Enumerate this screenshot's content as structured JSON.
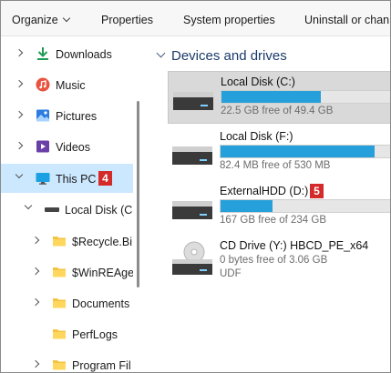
{
  "toolbar": {
    "organize": "Organize",
    "properties": "Properties",
    "system_properties": "System properties",
    "uninstall": "Uninstall or chan"
  },
  "nav": {
    "items": [
      {
        "label": "Downloads",
        "icon": "download-icon"
      },
      {
        "label": "Music",
        "icon": "music-icon"
      },
      {
        "label": "Pictures",
        "icon": "pictures-icon"
      },
      {
        "label": "Videos",
        "icon": "videos-icon"
      },
      {
        "label": "This PC",
        "icon": "computer-icon",
        "badge": "4",
        "selected": true
      },
      {
        "label": "Local Disk (C",
        "icon": "drive-icon"
      },
      {
        "label": "$Recycle.Bi",
        "icon": "folder-icon"
      },
      {
        "label": "$WinREAge",
        "icon": "folder-icon"
      },
      {
        "label": "Documents",
        "icon": "folder-icon"
      },
      {
        "label": "PerfLogs",
        "icon": "folder-icon"
      },
      {
        "label": "Program Fil",
        "icon": "folder-icon"
      }
    ]
  },
  "content": {
    "section_title": "Devices and drives",
    "drives": [
      {
        "name": "Local Disk (C:)",
        "free": "22.5 GB free of 49.4 GB",
        "used_fraction": 0.545,
        "selected": true
      },
      {
        "name": "Local Disk (F:)",
        "free": "82.4 MB free of 530 MB",
        "used_fraction": 0.845
      },
      {
        "name": "ExternalHDD (D:)",
        "free": "167 GB free of 234 GB",
        "used_fraction": 0.286,
        "badge": "5"
      },
      {
        "name": "CD Drive (Y:) HBCD_PE_x64",
        "free": "0 bytes free of 3.06 GB",
        "filesystem": "UDF"
      }
    ]
  },
  "colors": {
    "accent_bar": "#26a0da",
    "selection": "#cce8ff",
    "badge": "#d32a2a"
  }
}
